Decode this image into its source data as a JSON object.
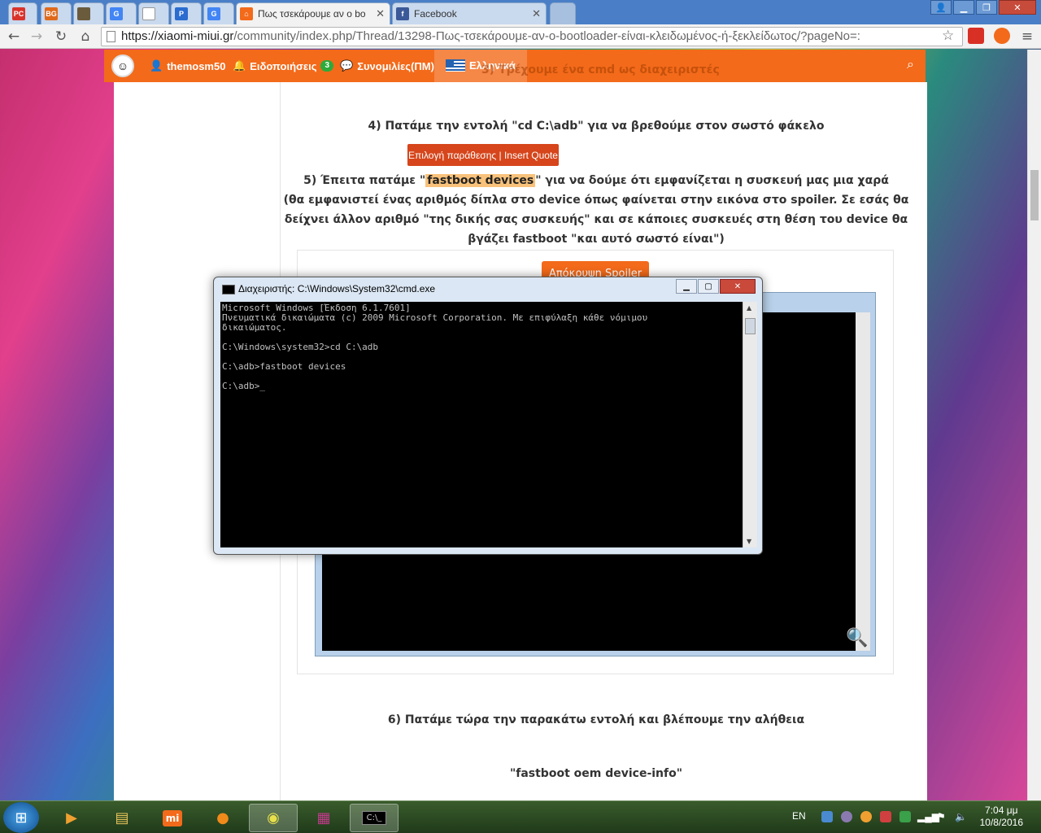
{
  "browser": {
    "tabs": [
      {
        "label": "",
        "favicon_text": "PC",
        "color": "#d9342b"
      },
      {
        "label": "",
        "favicon_text": "BG",
        "color": "#e06a1b"
      },
      {
        "label": "",
        "favicon_text": "",
        "color": "#6b5b3d"
      },
      {
        "label": "",
        "favicon_text": "G",
        "color": "#4285f4"
      },
      {
        "label": "",
        "favicon_text": "",
        "color": "#9aa4b0"
      },
      {
        "label": "",
        "favicon_text": "P",
        "color": "#2a6ccf"
      },
      {
        "label": "",
        "favicon_text": "G",
        "color": "#4285f4"
      },
      {
        "label": "Πως τσεκάρουμε αν ο bo",
        "favicon_text": "",
        "color": "#f36a1a"
      },
      {
        "label": "Facebook",
        "favicon_text": "f",
        "color": "#3b5998"
      }
    ],
    "url_host": "https://xiaomi-miui.gr",
    "url_path": "/community/index.php/Thread/13298-Πως-τσεκάρουμε-αν-ο-bootloader-είναι-κλειδωμένος-ή-ξεκλείδωτος/?pageNo=:",
    "colors": {
      "accent": "#f36a1a",
      "highlight": "#f9c27a"
    }
  },
  "sitenav": {
    "username": "themosm50",
    "notifications_label": "Ειδοποιήσεις",
    "notifications_count": "3",
    "conversations_label": "Συνομιλίες(ΠΜ)",
    "language_label": "Ελληνικά",
    "ghost_text": "3) Τρέχουμε ένα cmd ως διαχειριστές"
  },
  "post": {
    "step4": "4) Πατάμε την εντολή \"cd C:\\adb\" για να βρεθούμε στον σωστό φάκελο",
    "quote_tooltip": "Επιλογή παράθεσης | Insert Quote",
    "step5_prefix": "5) Έπειτα πατάμε \"",
    "step5_highlight": "fastboot devices",
    "step5_suffix": "\" για να δούμε ότι εμφανίζεται η συσκευή μας μια χαρά",
    "step5_line2": "(θα εμφανιστεί ένας αριθμός δίπλα στο device όπως φαίνεται στην εικόνα στο spoiler. Σε εσάς θα",
    "step5_line3": "δείχνει άλλον αριθμό \"της δικής σας συσκευής\" και σε κάποιες συσκευές στη θέση του device θα",
    "step5_line4": "βγάζει fastboot \"και αυτό σωστό είναι\")",
    "spoiler_button": "Απόκρυψη Spoiler",
    "step6": "6) Πατάμε τώρα την παρακάτω εντολή και βλέπουμε την αλήθεια",
    "command": "\"fastboot oem device-info\""
  },
  "cmd_window": {
    "title": "Διαχειριστής: C:\\Windows\\System32\\cmd.exe",
    "line1": "Microsoft Windows [Έκδοση 6.1.7601]",
    "line2": "Πνευματικά δικαιώματα (c) 2009 Microsoft Corporation. Με επιφύλαξη κάθε νόμιμου",
    "line3": "δικαιώματος.",
    "line4": "C:\\Windows\\system32>cd C:\\adb",
    "line5": "C:\\adb>fastboot devices",
    "line6": "C:\\adb>_"
  },
  "taskbar": {
    "apps": [
      "media-player-icon",
      "file-explorer-icon",
      "mi-icon",
      "firefox-icon",
      "chrome-icon",
      "winrar-icon",
      "cmd-icon"
    ],
    "language": "EN",
    "time": "7:04 μμ",
    "date": "10/8/2016"
  }
}
